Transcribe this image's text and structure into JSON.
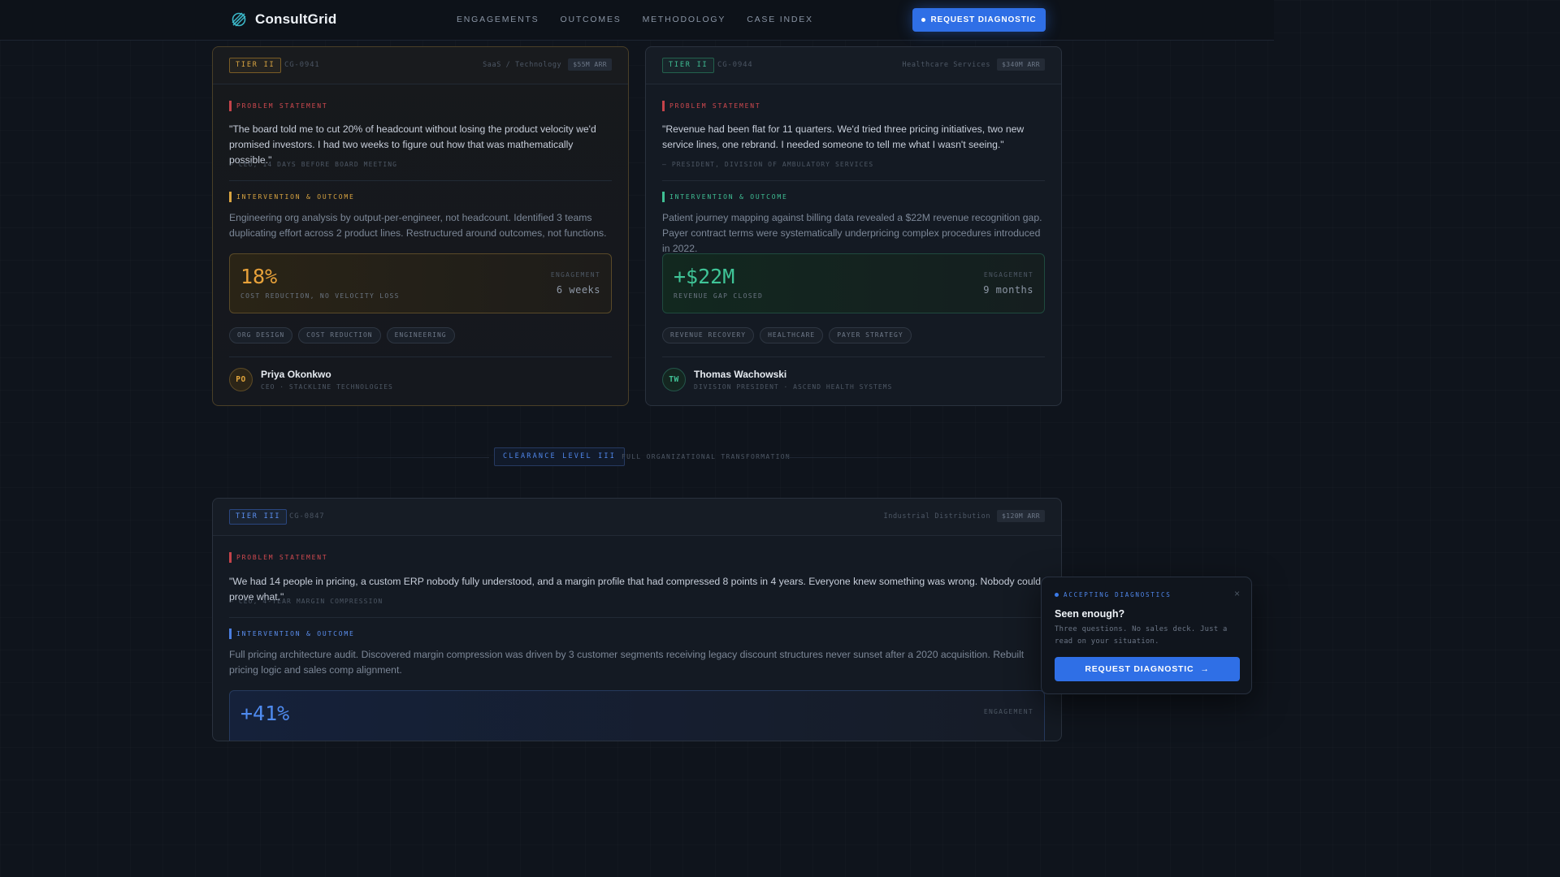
{
  "nav": {
    "brand": "ConsultGrid",
    "links": [
      "ENGAGEMENTS",
      "OUTCOMES",
      "METHODOLOGY",
      "CASE INDEX"
    ],
    "cta": "REQUEST DIAGNOSTIC"
  },
  "cards": [
    {
      "tier": "TIER II",
      "case_id": "CG-0941",
      "sector": "SaaS / Technology",
      "arr": "$55M ARR",
      "problem_label": "PROBLEM STATEMENT",
      "quote": "\"The board told me to cut 20% of headcount without losing the product velocity we'd promised investors. I had two weeks to figure out how that was mathematically possible.\"",
      "attribution": "— CEO, 14 DAYS BEFORE BOARD MEETING",
      "outcome_label": "INTERVENTION & OUTCOME",
      "outcome": "Engineering org analysis by output-per-engineer, not headcount. Identified 3 teams duplicating effort across 2 product lines. Restructured around outcomes, not functions.",
      "metric_value": "18%",
      "metric_caption": "COST REDUCTION, NO VELOCITY LOSS",
      "engagement_label": "ENGAGEMENT",
      "engagement_value": "6 weeks",
      "tags": [
        "ORG DESIGN",
        "COST REDUCTION",
        "ENGINEERING"
      ],
      "person_initials": "PO",
      "person_name": "Priya Okonkwo",
      "person_role": "CEO · STACKLINE TECHNOLOGIES"
    },
    {
      "tier": "TIER II",
      "case_id": "CG-0944",
      "sector": "Healthcare Services",
      "arr": "$340M ARR",
      "problem_label": "PROBLEM STATEMENT",
      "quote": "\"Revenue had been flat for 11 quarters. We'd tried three pricing initiatives, two new service lines, one rebrand. I needed someone to tell me what I wasn't seeing.\"",
      "attribution": "— PRESIDENT, DIVISION OF AMBULATORY SERVICES",
      "outcome_label": "INTERVENTION & OUTCOME",
      "outcome": "Patient journey mapping against billing data revealed a $22M revenue recognition gap. Payer contract terms were systematically underpricing complex procedures introduced in 2022.",
      "metric_value": "+$22M",
      "metric_caption": "REVENUE GAP CLOSED",
      "engagement_label": "ENGAGEMENT",
      "engagement_value": "9 months",
      "tags": [
        "REVENUE RECOVERY",
        "HEALTHCARE",
        "PAYER STRATEGY"
      ],
      "person_initials": "TW",
      "person_name": "Thomas Wachowski",
      "person_role": "DIVISION PRESIDENT · ASCEND HEALTH SYSTEMS"
    },
    {
      "tier": "TIER III",
      "case_id": "CG-0847",
      "sector": "Industrial Distribution",
      "arr": "$120M ARR",
      "problem_label": "PROBLEM STATEMENT",
      "quote": "\"We had 14 people in pricing, a custom ERP nobody fully understood, and a margin profile that had compressed 8 points in 4 years. Everyone knew something was wrong. Nobody could prove what.\"",
      "attribution": "— CEO, 4-YEAR MARGIN COMPRESSION",
      "outcome_label": "INTERVENTION & OUTCOME",
      "outcome": "Full pricing architecture audit. Discovered margin compression was driven by 3 customer segments receiving legacy discount structures never sunset after a 2020 acquisition. Rebuilt pricing logic and sales comp alignment.",
      "metric_value": "+41%",
      "engagement_label": "ENGAGEMENT"
    }
  ],
  "clearance": {
    "badge": "CLEARANCE LEVEL III",
    "text": "FULL ORGANIZATIONAL TRANSFORMATION"
  },
  "popup": {
    "status": "ACCEPTING DIAGNOSTICS",
    "close": "×",
    "title": "Seen enough?",
    "text": "Three questions. No sales deck. Just a read on your situation.",
    "cta": "REQUEST DIAGNOSTIC",
    "cta_arrow": "→"
  }
}
